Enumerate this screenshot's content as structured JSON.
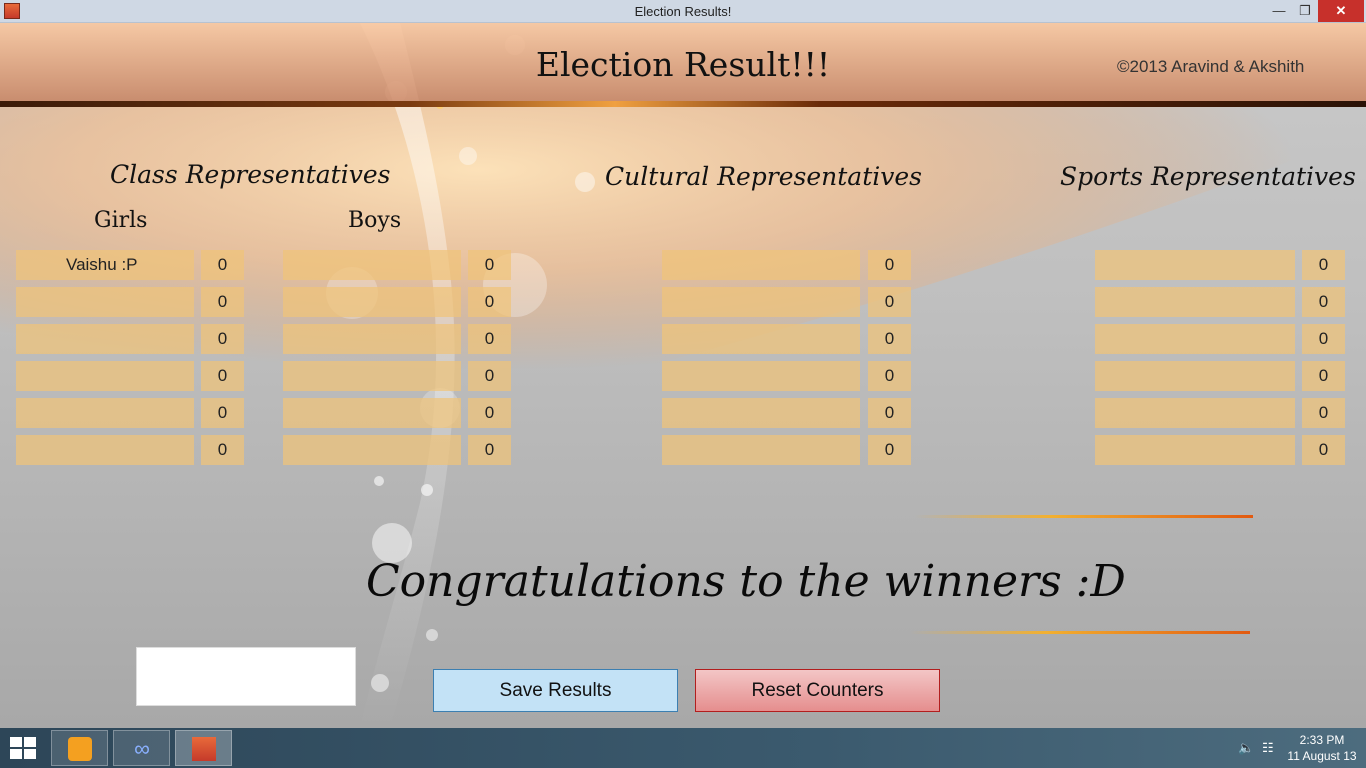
{
  "window": {
    "title": "Election Results!"
  },
  "header": {
    "title": "Election Result!!!",
    "copyright": "©2013 Aravind & Akshith"
  },
  "sections": {
    "class": {
      "label": "Class Representatives",
      "girls_label": "Girls",
      "boys_label": "Boys"
    },
    "cultural": {
      "label": "Cultural Representatives"
    },
    "sports": {
      "label": "Sports Representatives"
    }
  },
  "girls": [
    {
      "name": "Vaishu :P",
      "count": "0"
    },
    {
      "name": "",
      "count": "0"
    },
    {
      "name": "",
      "count": "0"
    },
    {
      "name": "",
      "count": "0"
    },
    {
      "name": "",
      "count": "0"
    },
    {
      "name": "",
      "count": "0"
    }
  ],
  "boys": [
    {
      "name": "",
      "count": "0"
    },
    {
      "name": "",
      "count": "0"
    },
    {
      "name": "",
      "count": "0"
    },
    {
      "name": "",
      "count": "0"
    },
    {
      "name": "",
      "count": "0"
    },
    {
      "name": "",
      "count": "0"
    }
  ],
  "cultural": [
    {
      "name": "",
      "count": "0"
    },
    {
      "name": "",
      "count": "0"
    },
    {
      "name": "",
      "count": "0"
    },
    {
      "name": "",
      "count": "0"
    },
    {
      "name": "",
      "count": "0"
    },
    {
      "name": "",
      "count": "0"
    }
  ],
  "sports": [
    {
      "name": "",
      "count": "0"
    },
    {
      "name": "",
      "count": "0"
    },
    {
      "name": "",
      "count": "0"
    },
    {
      "name": "",
      "count": "0"
    },
    {
      "name": "",
      "count": "0"
    },
    {
      "name": "",
      "count": "0"
    }
  ],
  "congrats": "Congratulations to the winners :D",
  "buttons": {
    "save": "Save Results",
    "reset": "Reset Counters"
  },
  "taskbar": {
    "time": "2:33 PM",
    "date": "11 August 13",
    "items": [
      "media-player-icon",
      "infinity-app-icon",
      "election-app-icon"
    ]
  },
  "colors": {
    "accent_orange": "#f2b030",
    "close_red": "#c7302b",
    "save_blue": "#c3e2f6",
    "reset_red": "#e58e8e"
  }
}
